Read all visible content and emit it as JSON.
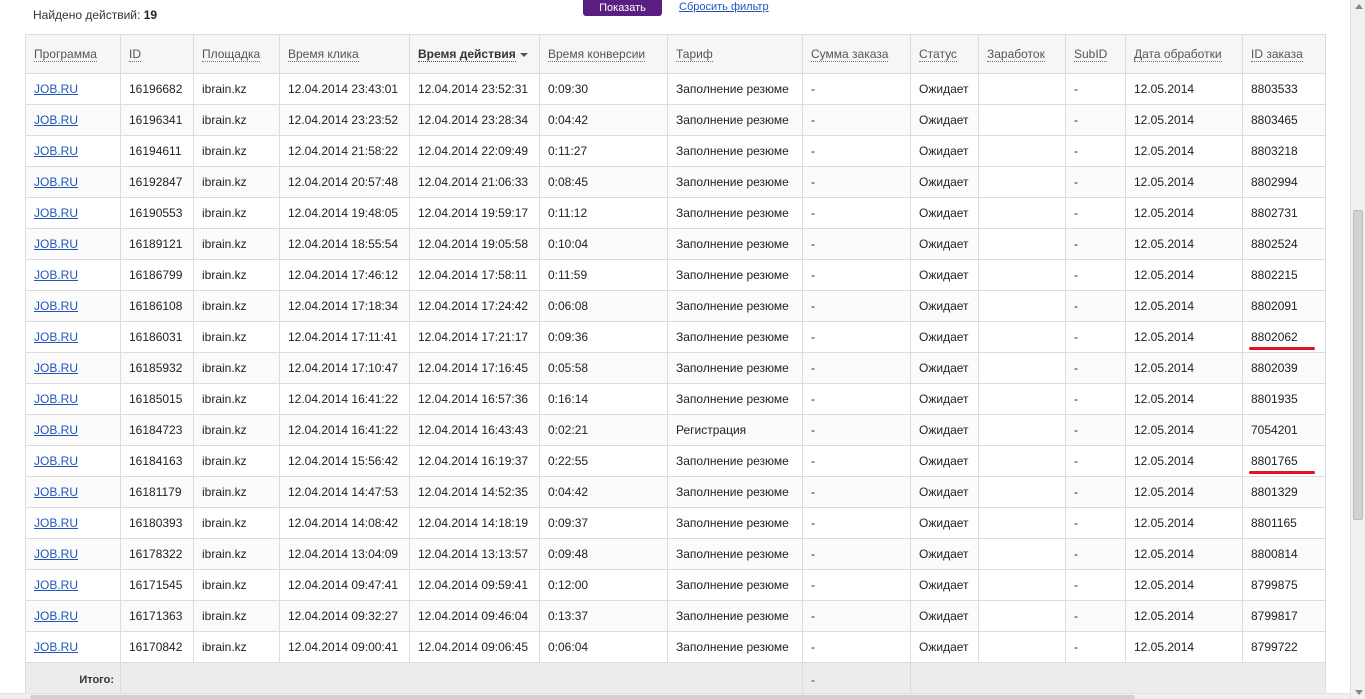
{
  "filter": {
    "found_label": "Найдено действий:",
    "found_count": "19",
    "show_button": "Показать",
    "reset_link": "Сбросить фильтр"
  },
  "columns": [
    "Программа",
    "ID",
    "Площадка",
    "Время клика",
    "Время действия",
    "Время конверсии",
    "Тариф",
    "Сумма заказа",
    "Статус",
    "Заработок",
    "SubID",
    "Дата обработки",
    "ID заказа"
  ],
  "rows": [
    [
      "JOB.RU",
      "16196682",
      "ibrain.kz",
      "12.04.2014 23:43:01",
      "12.04.2014 23:52:31",
      "0:09:30",
      "Заполнение резюме",
      "-",
      "Ожидает",
      "",
      "-",
      "12.05.2014",
      "8803533"
    ],
    [
      "JOB.RU",
      "16196341",
      "ibrain.kz",
      "12.04.2014 23:23:52",
      "12.04.2014 23:28:34",
      "0:04:42",
      "Заполнение резюме",
      "-",
      "Ожидает",
      "",
      "-",
      "12.05.2014",
      "8803465"
    ],
    [
      "JOB.RU",
      "16194611",
      "ibrain.kz",
      "12.04.2014 21:58:22",
      "12.04.2014 22:09:49",
      "0:11:27",
      "Заполнение резюме",
      "-",
      "Ожидает",
      "",
      "-",
      "12.05.2014",
      "8803218"
    ],
    [
      "JOB.RU",
      "16192847",
      "ibrain.kz",
      "12.04.2014 20:57:48",
      "12.04.2014 21:06:33",
      "0:08:45",
      "Заполнение резюме",
      "-",
      "Ожидает",
      "",
      "-",
      "12.05.2014",
      "8802994"
    ],
    [
      "JOB.RU",
      "16190553",
      "ibrain.kz",
      "12.04.2014 19:48:05",
      "12.04.2014 19:59:17",
      "0:11:12",
      "Заполнение резюме",
      "-",
      "Ожидает",
      "",
      "-",
      "12.05.2014",
      "8802731"
    ],
    [
      "JOB.RU",
      "16189121",
      "ibrain.kz",
      "12.04.2014 18:55:54",
      "12.04.2014 19:05:58",
      "0:10:04",
      "Заполнение резюме",
      "-",
      "Ожидает",
      "",
      "-",
      "12.05.2014",
      "8802524"
    ],
    [
      "JOB.RU",
      "16186799",
      "ibrain.kz",
      "12.04.2014 17:46:12",
      "12.04.2014 17:58:11",
      "0:11:59",
      "Заполнение резюме",
      "-",
      "Ожидает",
      "",
      "-",
      "12.05.2014",
      "8802215"
    ],
    [
      "JOB.RU",
      "16186108",
      "ibrain.kz",
      "12.04.2014 17:18:34",
      "12.04.2014 17:24:42",
      "0:06:08",
      "Заполнение резюме",
      "-",
      "Ожидает",
      "",
      "-",
      "12.05.2014",
      "8802091"
    ],
    [
      "JOB.RU",
      "16186031",
      "ibrain.kz",
      "12.04.2014 17:11:41",
      "12.04.2014 17:21:17",
      "0:09:36",
      "Заполнение резюме",
      "-",
      "Ожидает",
      "",
      "-",
      "12.05.2014",
      "8802062"
    ],
    [
      "JOB.RU",
      "16185932",
      "ibrain.kz",
      "12.04.2014 17:10:47",
      "12.04.2014 17:16:45",
      "0:05:58",
      "Заполнение резюме",
      "-",
      "Ожидает",
      "",
      "-",
      "12.05.2014",
      "8802039"
    ],
    [
      "JOB.RU",
      "16185015",
      "ibrain.kz",
      "12.04.2014 16:41:22",
      "12.04.2014 16:57:36",
      "0:16:14",
      "Заполнение резюме",
      "-",
      "Ожидает",
      "",
      "-",
      "12.05.2014",
      "8801935"
    ],
    [
      "JOB.RU",
      "16184723",
      "ibrain.kz",
      "12.04.2014 16:41:22",
      "12.04.2014 16:43:43",
      "0:02:21",
      "Регистрация",
      "-",
      "Ожидает",
      "",
      "-",
      "12.05.2014",
      "7054201"
    ],
    [
      "JOB.RU",
      "16184163",
      "ibrain.kz",
      "12.04.2014 15:56:42",
      "12.04.2014 16:19:37",
      "0:22:55",
      "Заполнение резюме",
      "-",
      "Ожидает",
      "",
      "-",
      "12.05.2014",
      "8801765"
    ],
    [
      "JOB.RU",
      "16181179",
      "ibrain.kz",
      "12.04.2014 14:47:53",
      "12.04.2014 14:52:35",
      "0:04:42",
      "Заполнение резюме",
      "-",
      "Ожидает",
      "",
      "-",
      "12.05.2014",
      "8801329"
    ],
    [
      "JOB.RU",
      "16180393",
      "ibrain.kz",
      "12.04.2014 14:08:42",
      "12.04.2014 14:18:19",
      "0:09:37",
      "Заполнение резюме",
      "-",
      "Ожидает",
      "",
      "-",
      "12.05.2014",
      "8801165"
    ],
    [
      "JOB.RU",
      "16178322",
      "ibrain.kz",
      "12.04.2014 13:04:09",
      "12.04.2014 13:13:57",
      "0:09:48",
      "Заполнение резюме",
      "-",
      "Ожидает",
      "",
      "-",
      "12.05.2014",
      "8800814"
    ],
    [
      "JOB.RU",
      "16171545",
      "ibrain.kz",
      "12.04.2014 09:47:41",
      "12.04.2014 09:59:41",
      "0:12:00",
      "Заполнение резюме",
      "-",
      "Ожидает",
      "",
      "-",
      "12.05.2014",
      "8799875"
    ],
    [
      "JOB.RU",
      "16171363",
      "ibrain.kz",
      "12.04.2014 09:32:27",
      "12.04.2014 09:46:04",
      "0:13:37",
      "Заполнение резюме",
      "-",
      "Ожидает",
      "",
      "-",
      "12.05.2014",
      "8799817"
    ],
    [
      "JOB.RU",
      "16170842",
      "ibrain.kz",
      "12.04.2014 09:00:41",
      "12.04.2014 09:06:45",
      "0:06:04",
      "Заполнение резюме",
      "-",
      "Ожидает",
      "",
      "-",
      "12.05.2014",
      "8799722"
    ]
  ],
  "marked_rows": [
    8,
    12
  ],
  "sorted_column": 4,
  "totals": {
    "label": "Итого:",
    "order_sum": "-"
  },
  "colors": {
    "accent": "#5a1d80",
    "link": "#2255bb",
    "marker": "#e0141e"
  }
}
